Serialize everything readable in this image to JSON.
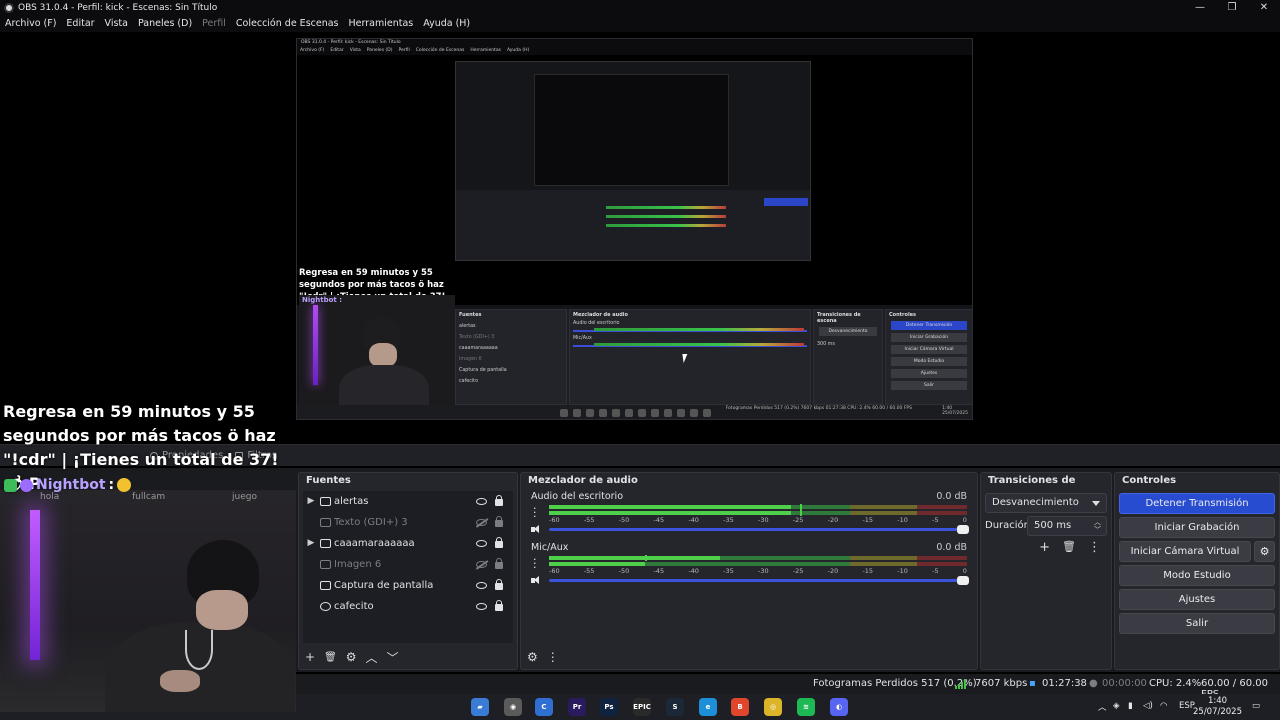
{
  "window": {
    "title": "OBS 31.0.4 - Perfil: kick - Escenas: Sin Título",
    "controls": [
      "—",
      "❐",
      "✕"
    ]
  },
  "menu": [
    {
      "label": "Archivo (F)",
      "enabled": true
    },
    {
      "label": "Editar",
      "enabled": true
    },
    {
      "label": "Vista",
      "enabled": true
    },
    {
      "label": "Paneles (D)",
      "enabled": true
    },
    {
      "label": "Perfil",
      "enabled": false
    },
    {
      "label": "Colección de Escenas",
      "enabled": true
    },
    {
      "label": "Herramientas",
      "enabled": true
    },
    {
      "label": "Ayuda (H)",
      "enabled": true
    }
  ],
  "nested_preview": {
    "title": "OBS 31.0.4 - Perfil: kick - Escenas: Sin Título",
    "menu": [
      "Archivo (F)",
      "Editar",
      "Vista",
      "Paneles (D)",
      "Perfil",
      "Colección de Escenas",
      "Herramientas",
      "Ayuda (H)"
    ],
    "overlay": "Regresa en 59 minutos y 55 segundos por más tacos ö haz \"!cdr\" | ¡Tienes un total de 37! 🌶 P",
    "nightbot": "Nightbot :",
    "docks": {
      "sources": "Fuentes",
      "mixer": "Mezclador de audio",
      "transitions": "Transiciones de escena",
      "controls": "Controles"
    },
    "source_items": [
      "alertas",
      "Texto (GDI+) 3",
      "caaamaraaaaaa",
      "Imagen 6",
      "Captura de pantalla",
      "cafecito"
    ],
    "mixer_tracks": [
      "Audio del escritorio",
      "Mic/Aux"
    ],
    "transition": "Desvanecimiento",
    "duration": "300 ms",
    "control_buttons": [
      "Detener Transmisión",
      "Iniciar Grabación",
      "Iniciar Cámara Virtual",
      "Modo Estudio",
      "Ajustes",
      "Salir"
    ],
    "status": "Fotogramas Perdidos 517 (0.2%)   7607 kbps   01:27:38   CPU: 2.4%   60.00 / 60.00 FPS",
    "clock": "1:40\n25/07/2025"
  },
  "overlay": {
    "message": "Regresa en 59 minutos y 55 segundos por más tacos ö haz \"!cdr\" | ¡Tienes un total de 37! 🌶 P",
    "nightbot_name": "Nightbot",
    "nightbot_colon": ":",
    "nightbot_color": "#b9a2ff"
  },
  "webcam_tabs": [
    "hola",
    "fullcam",
    "juego"
  ],
  "docks_tabs": {
    "properties": "Propiedades",
    "filters": "Filtros"
  },
  "sources": {
    "title": "Fuentes",
    "items": [
      {
        "name": "alertas",
        "icon": "folder-icon",
        "expandable": true,
        "visible": true,
        "locked": true,
        "dim": false
      },
      {
        "name": "Texto (GDI+) 3",
        "icon": "text-icon",
        "expandable": false,
        "visible": false,
        "locked": true,
        "dim": true
      },
      {
        "name": "caaamaraaaaaa",
        "icon": "folder-icon",
        "expandable": true,
        "visible": true,
        "locked": true,
        "dim": false
      },
      {
        "name": "Imagen 6",
        "icon": "image-icon",
        "expandable": false,
        "visible": false,
        "locked": true,
        "dim": true
      },
      {
        "name": "Captura de pantalla",
        "icon": "monitor-icon",
        "expandable": false,
        "visible": true,
        "locked": true,
        "dim": false
      },
      {
        "name": "cafecito",
        "icon": "browser-icon",
        "expandable": false,
        "visible": true,
        "locked": true,
        "dim": false
      }
    ],
    "toolbar": [
      "+",
      "🗑",
      "⚙",
      "︿",
      "﹀"
    ]
  },
  "mixer": {
    "title": "Mezclador de audio",
    "ticks": [
      "-60",
      "-55",
      "-50",
      "-45",
      "-40",
      "-35",
      "-30",
      "-25",
      "-20",
      "-15",
      "-10",
      "-5",
      "0"
    ],
    "tracks": [
      {
        "name": "Audio del escritorio",
        "db": "0.0 dB",
        "level_fraction": 0.58,
        "peak_fraction": 0.6,
        "volume_fraction": 1.0
      },
      {
        "name": "Mic/Aux",
        "db": "0.0 dB",
        "level_fraction": 0.41,
        "peak_fraction": 0.23,
        "volume_fraction": 1.0
      }
    ]
  },
  "transitions": {
    "title": "Transiciones de escena",
    "selected": "Desvanecimiento",
    "duration_label": "Duración",
    "duration_value": "500 ms"
  },
  "controls": {
    "title": "Controles",
    "buttons": [
      {
        "label": "Detener Transmisión",
        "active": true
      },
      {
        "label": "Iniciar Grabación",
        "active": false
      },
      {
        "label": "Iniciar Cámara Virtual",
        "active": false
      },
      {
        "label": "Modo Estudio",
        "active": false
      },
      {
        "label": "Ajustes",
        "active": false
      },
      {
        "label": "Salir",
        "active": false
      }
    ]
  },
  "status": {
    "dropped": "Fotogramas Perdidos 517 (0.2%)",
    "bitrate": "7607 kbps",
    "stream_time": "01:27:38",
    "rec_time": "00:00:00",
    "cpu": "CPU: 2.4%",
    "fps": "60.00 / 60.00 FPS"
  },
  "taskbar": {
    "apps": [
      {
        "name": "files-app-icon",
        "color": "#3a7bd5",
        "glyph": "▰"
      },
      {
        "name": "obs-app-icon",
        "color": "#5a5a5a",
        "glyph": "◉"
      },
      {
        "name": "ccleaner-app-icon",
        "color": "#2f6fd1",
        "glyph": "C"
      },
      {
        "name": "premiere-app-icon",
        "color": "#2a1a5e",
        "glyph": "Pr"
      },
      {
        "name": "photoshop-app-icon",
        "color": "#0f2340",
        "glyph": "Ps"
      },
      {
        "name": "epic-games-app-icon",
        "color": "#2a2a2a",
        "glyph": "EPIC"
      },
      {
        "name": "steam-app-icon",
        "color": "#1b2838",
        "glyph": "S"
      },
      {
        "name": "edge-app-icon",
        "color": "#1c8fd8",
        "glyph": "e"
      },
      {
        "name": "brave-app-icon",
        "color": "#e0462c",
        "glyph": "B"
      },
      {
        "name": "chrome-app-icon",
        "color": "#dcb429",
        "glyph": "◎"
      },
      {
        "name": "spotify-app-icon",
        "color": "#1db954",
        "glyph": "≋"
      },
      {
        "name": "discord-app-icon",
        "color": "#5865f2",
        "glyph": "◐"
      }
    ],
    "language": "ESP",
    "time": "1:40",
    "date": "25/07/2025"
  }
}
